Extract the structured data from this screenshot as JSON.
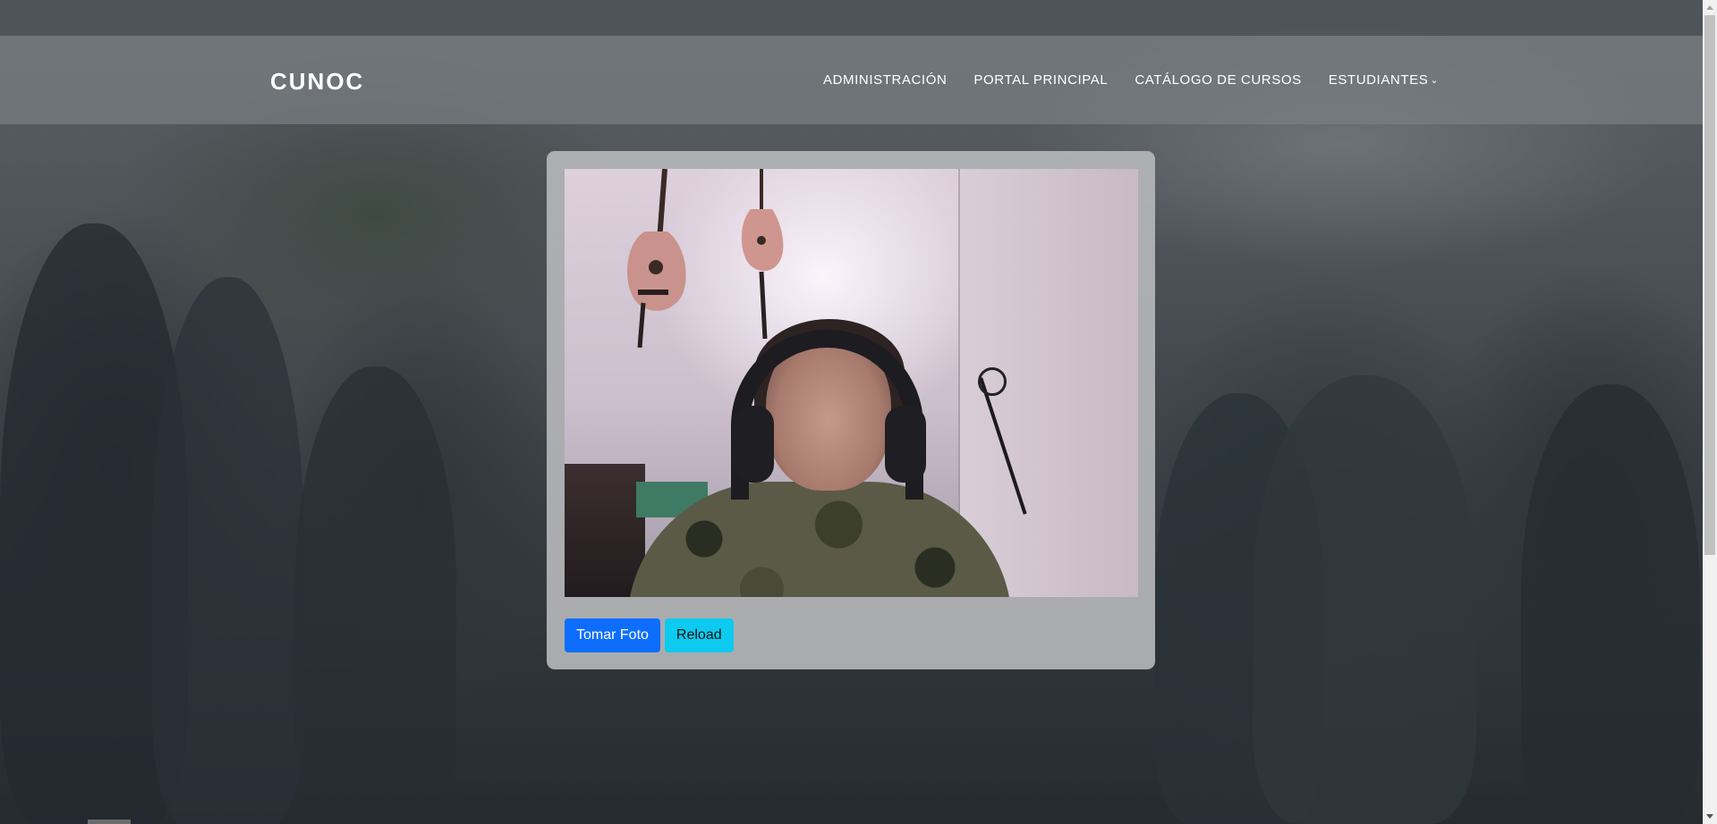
{
  "navbar": {
    "brand": "CUNOC",
    "links": [
      {
        "label": "ADMINISTRACIÓN"
      },
      {
        "label": "PORTAL PRINCIPAL"
      },
      {
        "label": "CATÁLOGO DE CURSOS"
      },
      {
        "label": "ESTUDIANTES"
      }
    ],
    "dropdown_icon": "chevron-down-icon"
  },
  "camera": {
    "take_photo_label": "Tomar Foto",
    "reload_label": "Reload"
  },
  "colors": {
    "primary_button": "#0d6efd",
    "info_button": "#0dcaf0",
    "navbar_bg": "rgba(120,126,130,0.72)",
    "card_bg": "rgba(180,182,184,0.92)"
  }
}
